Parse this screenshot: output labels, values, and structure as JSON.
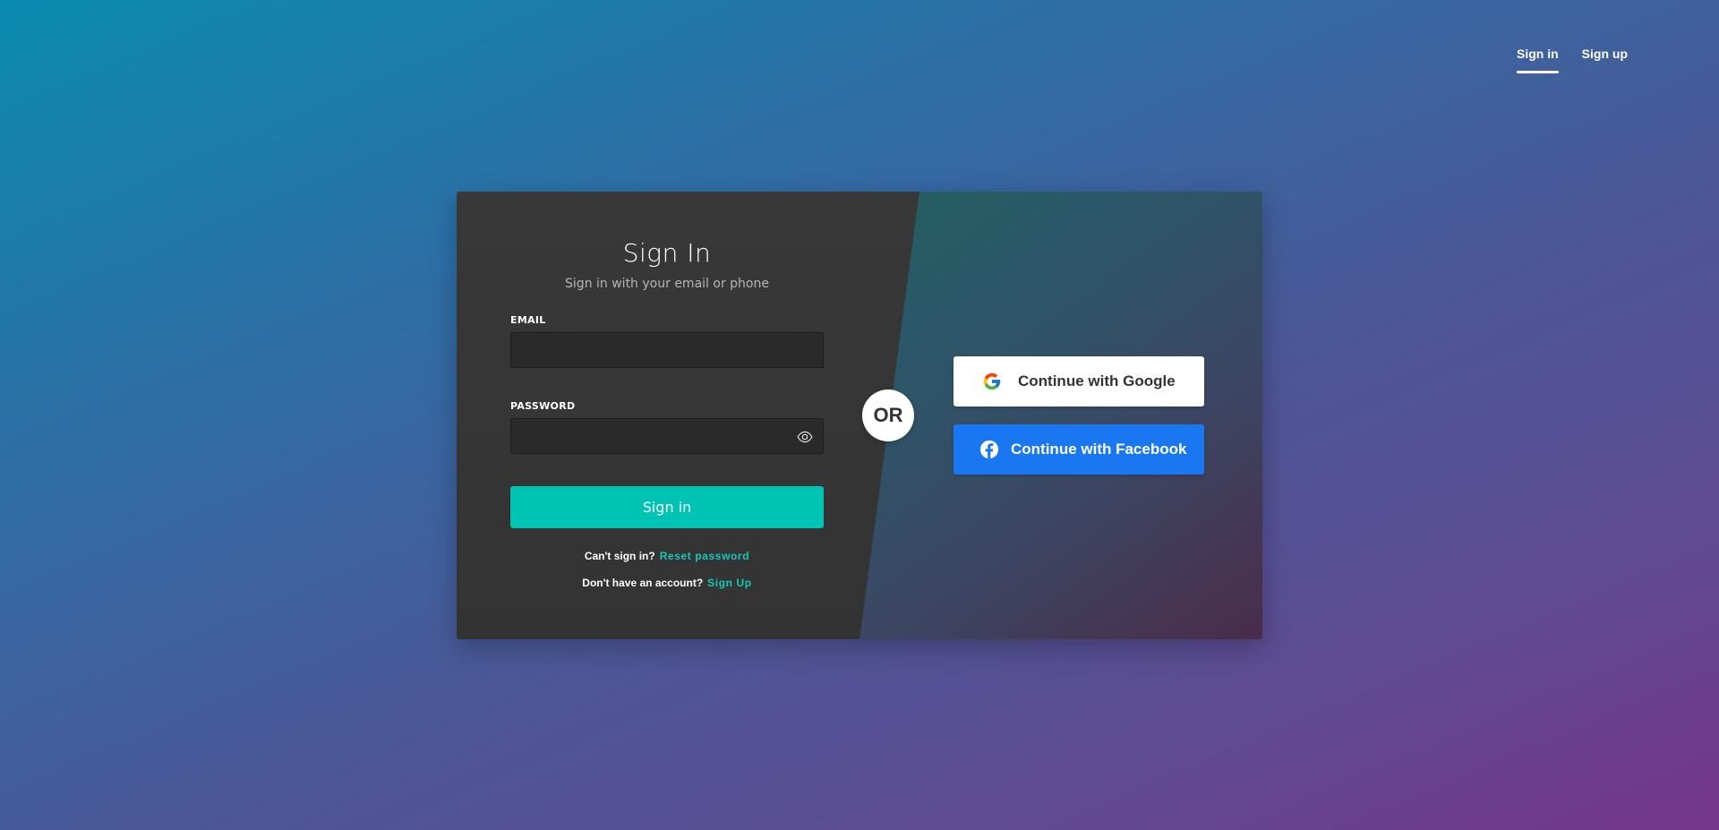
{
  "nav": {
    "items": [
      {
        "label": "Sign in",
        "active": true
      },
      {
        "label": "Sign up",
        "active": false
      }
    ]
  },
  "form": {
    "title": "Sign In",
    "subtitle": "Sign in with your email or phone",
    "email": {
      "label": "EMAIL",
      "value": "",
      "placeholder": ""
    },
    "password": {
      "label": "PASSWORD",
      "value": "",
      "placeholder": "",
      "toggle_icon": "eye-icon"
    },
    "submit_label": "Sign in",
    "reset": {
      "prompt": "Can't sign in?",
      "link": "Reset password"
    },
    "signup": {
      "prompt": "Don't have an account?",
      "link": "Sign Up"
    }
  },
  "divider": {
    "label": "OR"
  },
  "social": {
    "google": {
      "label": "Continue with Google",
      "icon": "google-icon"
    },
    "facebook": {
      "label": "Continue with Facebook",
      "icon": "facebook-icon"
    }
  },
  "colors": {
    "accent": "#00c4b3",
    "facebook": "#1a77f2",
    "panel_dark": "#363636"
  }
}
